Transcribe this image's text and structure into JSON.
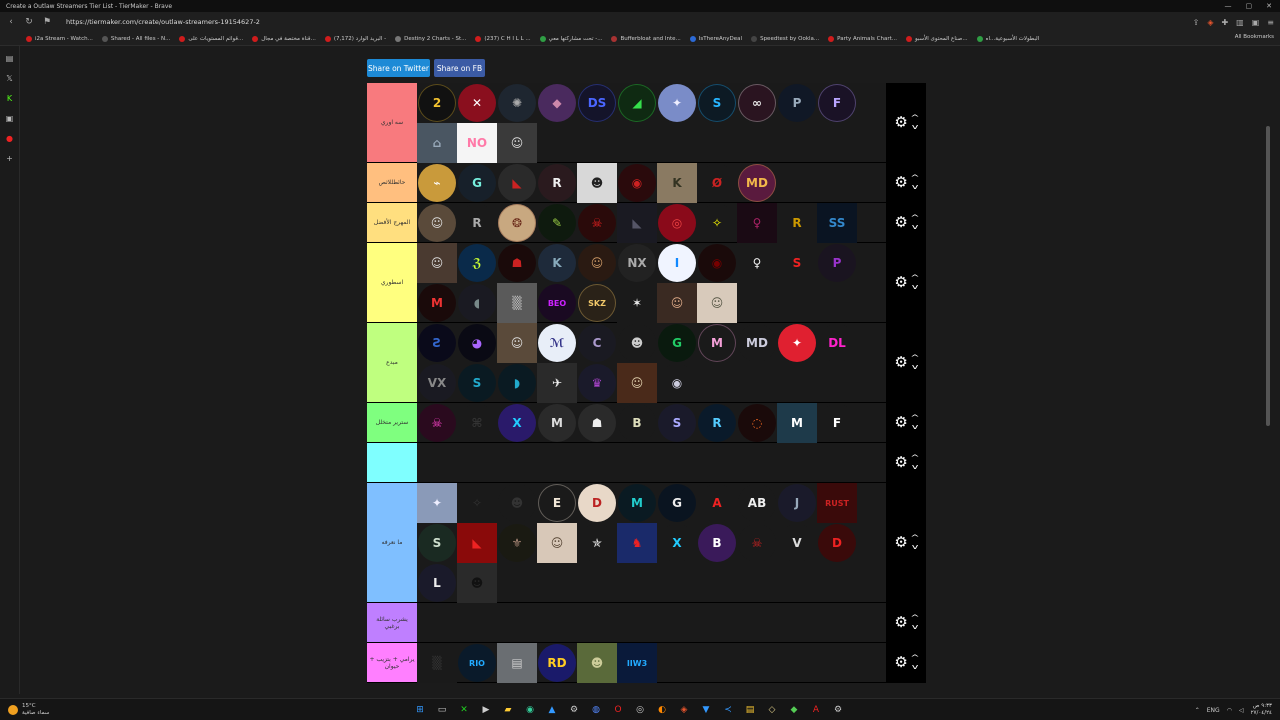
{
  "window": {
    "title": "Create a Outlaw Streamers Tier List - TierMaker - Brave"
  },
  "address_bar": {
    "url": "https://tiermaker.com/create/outlaw-streamers-19154627-2"
  },
  "bookmarks": [
    {
      "label": "i2a Stream - Watch...",
      "color": "#d01c1c"
    },
    {
      "label": "Shared - All files - N...",
      "color": "#555555"
    },
    {
      "label": "قوائم المستويات على...",
      "color": "#d01c1c"
    },
    {
      "label": "قناة مختصة في مجال...",
      "color": "#d01c1c"
    },
    {
      "label": "البريد الوارد (7,172) -",
      "color": "#d01c1c"
    },
    {
      "label": "Destiny 2 Charts - St...",
      "color": "#777777"
    },
    {
      "label": "(237) C H I L L ...",
      "color": "#d01c1c"
    },
    {
      "label": "تحت مشاركتها معي -...",
      "color": "#2f9e44"
    },
    {
      "label": "Bufferbloat and Inte...",
      "color": "#a83232"
    },
    {
      "label": "IsThereAnyDeal",
      "color": "#2c6ad6"
    },
    {
      "label": "Speedtest by Ookla...",
      "color": "#444444"
    },
    {
      "label": "Party Animals Chart...",
      "color": "#d01c1c"
    },
    {
      "label": "صناع المحتوى الأسبو...",
      "color": "#d01c1c"
    },
    {
      "label": "البطولات الأسبوعية...اه",
      "color": "#2f9e44"
    }
  ],
  "bookmarks_all": "All Bookmarks",
  "share": {
    "twitter": "Share on Twitter",
    "facebook": "Share on FB"
  },
  "tiers": [
    {
      "label": "سه اوري",
      "color": "#f87a7e",
      "height": 80,
      "items": [
        {
          "t": "2",
          "bg": "#111",
          "fg": "#f2c230",
          "s": "circ"
        },
        {
          "t": "✕",
          "bg": "#8a0f1e",
          "fg": "#fff"
        },
        {
          "t": "✺",
          "bg": "#1e2630",
          "fg": "#aaa"
        },
        {
          "t": "◆",
          "bg": "#4a2a5e",
          "fg": "#c8a"
        },
        {
          "t": "DS",
          "bg": "#14142a",
          "fg": "#4a66ff"
        },
        {
          "t": "◢",
          "bg": "#0f2a12",
          "fg": "#35e04b"
        },
        {
          "t": "✦",
          "bg": "#7a8cc8",
          "fg": "#eef"
        },
        {
          "t": "S",
          "bg": "#0d1a24",
          "fg": "#27b5ff"
        },
        {
          "t": "∞",
          "bg": "#2a1420",
          "fg": "#e8e8e8"
        },
        {
          "t": "P",
          "bg": "#101826",
          "fg": "#9ab"
        },
        {
          "t": "F",
          "bg": "#1a1226",
          "fg": "#b9a5ff"
        },
        {
          "t": "⌂",
          "bg": "#4a5662",
          "fg": "#9ab",
          "sq": true
        },
        {
          "t": "NO",
          "bg": "#f5f5f5",
          "fg": "#ff7aa8",
          "sq": true
        },
        {
          "t": "☺",
          "bg": "#3a3a3a",
          "fg": "#ddd",
          "sq": true
        }
      ]
    },
    {
      "label": "حائطللاثص",
      "color": "#ffbf7f",
      "height": 40,
      "items": [
        {
          "t": "⌁",
          "bg": "#c99a3b",
          "fg": "#fff"
        },
        {
          "t": "G",
          "bg": "#17202a",
          "fg": "#7ed"
        },
        {
          "t": "◣",
          "bg": "#2a2a2a",
          "fg": "#c22"
        },
        {
          "t": "R",
          "bg": "#2a1a1e",
          "fg": "#eee"
        },
        {
          "t": "☻",
          "bg": "#d8d8d8",
          "fg": "#222",
          "sq": true
        },
        {
          "t": "◉",
          "bg": "#2a0a0c",
          "fg": "#c22"
        },
        {
          "t": "K",
          "bg": "#8a7a62",
          "fg": "#332",
          "sq": true
        },
        {
          "t": "Ø",
          "bg": "#1a1a1a",
          "fg": "#c22"
        },
        {
          "t": "MD",
          "bg": "#5a1a3e",
          "fg": "#f2b84a"
        }
      ]
    },
    {
      "label": "المهرج الأفضل",
      "color": "#ffdf7f",
      "height": 40,
      "items": [
        {
          "t": "☺",
          "bg": "#5a4a3a",
          "fg": "#ddd"
        },
        {
          "t": "R",
          "bg": "#1a1a1a",
          "fg": "#aaa"
        },
        {
          "t": "❂",
          "bg": "#c8a880",
          "fg": "#6a2a1a"
        },
        {
          "t": "✎",
          "bg": "#0e1a0e",
          "fg": "#9c4"
        },
        {
          "t": "☠",
          "bg": "#2a0a0a",
          "fg": "#e22"
        },
        {
          "t": "◣",
          "bg": "#1a1a22",
          "fg": "#556",
          "sq": true
        },
        {
          "t": "◎",
          "bg": "#8a0a1a",
          "fg": "#e44"
        },
        {
          "t": "✧",
          "bg": "#1a1a1a",
          "fg": "#ff0"
        },
        {
          "t": "♀",
          "bg": "#1a0a14",
          "fg": "#a26",
          "sq": true
        },
        {
          "t": "R",
          "bg": "#1a1a1a",
          "fg": "#c90",
          "sq": true
        },
        {
          "t": "SS",
          "bg": "#0a1422",
          "fg": "#38c",
          "sq": true
        }
      ]
    },
    {
      "label": "اسطوري",
      "color": "#ffff7f",
      "height": 80,
      "items": [
        {
          "t": "☺",
          "bg": "#4a3a30",
          "fg": "#ddd",
          "sq": true
        },
        {
          "t": "ℨ",
          "bg": "#0a2a4a",
          "fg": "#cf3"
        },
        {
          "t": "☗",
          "bg": "#1a0a0a",
          "fg": "#c22"
        },
        {
          "t": "K",
          "bg": "#1e2a3a",
          "fg": "#8ab"
        },
        {
          "t": "☺",
          "bg": "#2a1a12",
          "fg": "#c96"
        },
        {
          "t": "NX",
          "bg": "#222",
          "fg": "#aaa"
        },
        {
          "t": "I",
          "bg": "#f0f4ff",
          "fg": "#18f"
        },
        {
          "t": "◉",
          "bg": "#1a0a0a",
          "fg": "#700"
        },
        {
          "t": "♀",
          "bg": "#1a1a1a",
          "fg": "#eee",
          "sq": true
        },
        {
          "t": "S",
          "bg": "#1a1a1a",
          "fg": "#e22",
          "sq": true
        },
        {
          "t": "P",
          "bg": "#1a1420",
          "fg": "#93c"
        },
        {
          "t": "M",
          "bg": "#1a0a0a",
          "fg": "#e33"
        },
        {
          "t": "◖",
          "bg": "#1a1a22",
          "fg": "#788"
        },
        {
          "t": "▒",
          "bg": "#5a5a5a",
          "fg": "#bbb",
          "sq": true
        },
        {
          "t": "BEO",
          "bg": "#1a0a22",
          "fg": "#c2f"
        },
        {
          "t": "SKZ",
          "bg": "#2a2218",
          "fg": "#f2c96a"
        },
        {
          "t": "✶",
          "bg": "#1a1a1a",
          "fg": "#eee",
          "sq": true
        },
        {
          "t": "☺",
          "bg": "#3a2a22",
          "fg": "#da8",
          "sq": true
        },
        {
          "t": "☺",
          "bg": "#d8cabb",
          "fg": "#554",
          "sq": true
        }
      ]
    },
    {
      "label": "مبدع",
      "color": "#bfff7f",
      "height": 80,
      "items": [
        {
          "t": "Ƨ",
          "bg": "#0a0a1a",
          "fg": "#36c"
        },
        {
          "t": "◕",
          "bg": "#0a0a14",
          "fg": "#a6f"
        },
        {
          "t": "☺",
          "bg": "#5a4a3a",
          "fg": "#ddd",
          "sq": true
        },
        {
          "t": "ℳ",
          "bg": "#e8eef8",
          "fg": "#338"
        },
        {
          "t": "C",
          "bg": "#1a1a22",
          "fg": "#a9c"
        },
        {
          "t": "☻",
          "bg": "#1a1a1a",
          "fg": "#ccc"
        },
        {
          "t": "G",
          "bg": "#0a1a0e",
          "fg": "#2c6"
        },
        {
          "t": "M",
          "bg": "#1a1a1a",
          "fg": "#f4a0d8"
        },
        {
          "t": "MD",
          "bg": "#1a1a1a",
          "fg": "#ccd"
        },
        {
          "t": "✦",
          "bg": "#e02030",
          "fg": "#fff"
        },
        {
          "t": "DL",
          "bg": "#1a1a1a",
          "fg": "#f2c"
        },
        {
          "t": "VX",
          "bg": "#1a1a22",
          "fg": "#888"
        },
        {
          "t": "S",
          "bg": "#0a1a22",
          "fg": "#2ac"
        },
        {
          "t": "◗",
          "bg": "#0a1a22",
          "fg": "#2ac"
        },
        {
          "t": "✈",
          "bg": "#2a2a2a",
          "fg": "#eee",
          "sq": true
        },
        {
          "t": "♛",
          "bg": "#1a1a2a",
          "fg": "#a4c"
        },
        {
          "t": "☺",
          "bg": "#4a2a1a",
          "fg": "#dca",
          "sq": true
        },
        {
          "t": "◉",
          "bg": "#1a1a1a",
          "fg": "#ccd"
        }
      ]
    },
    {
      "label": "سترير متخلل",
      "color": "#7fff7f",
      "height": 40,
      "items": [
        {
          "t": "☠",
          "bg": "#2a0a1e",
          "fg": "#f4c"
        },
        {
          "t": "⌘",
          "bg": "#1a1a1a",
          "fg": "#333"
        },
        {
          "t": "X",
          "bg": "#2a1a6a",
          "fg": "#2cf"
        },
        {
          "t": "M",
          "bg": "#2a2a2a",
          "fg": "#ddd"
        },
        {
          "t": "☗",
          "bg": "#2a2a2a",
          "fg": "#eee"
        },
        {
          "t": "B",
          "bg": "#1a1a1a",
          "fg": "#ddb"
        },
        {
          "t": "S",
          "bg": "#1a1a2a",
          "fg": "#aaf"
        },
        {
          "t": "R",
          "bg": "#0a1a2a",
          "fg": "#5cf"
        },
        {
          "t": "◌",
          "bg": "#1a0a0a",
          "fg": "#e62"
        },
        {
          "t": "M",
          "bg": "#1e3a4a",
          "fg": "#fff",
          "sq": true
        },
        {
          "t": "F",
          "bg": "#1a1a1a",
          "fg": "#fff"
        }
      ]
    },
    {
      "label": "",
      "color": "#7fffff",
      "height": 40,
      "items": []
    },
    {
      "label": "ما نعرفه",
      "color": "#7fbfff",
      "height": 120,
      "items": [
        {
          "t": "✦",
          "bg": "#8a9ab8",
          "fg": "#eef",
          "sq": true
        },
        {
          "t": "✧",
          "bg": "#1a1a1a",
          "fg": "#333",
          "sq": true
        },
        {
          "t": "☻",
          "bg": "#1a1a1a",
          "fg": "#333"
        },
        {
          "t": "E",
          "bg": "#1a1a1a",
          "fg": "#f2e8d8"
        },
        {
          "t": "D",
          "bg": "#e8d8c8",
          "fg": "#b22"
        },
        {
          "t": "M",
          "bg": "#0a1a22",
          "fg": "#2cc"
        },
        {
          "t": "G",
          "bg": "#0a1420",
          "fg": "#eee"
        },
        {
          "t": "A",
          "bg": "#1a1a1a",
          "fg": "#e22"
        },
        {
          "t": "AB",
          "bg": "#1a1a1a",
          "fg": "#eee"
        },
        {
          "t": "J",
          "bg": "#1a1a2a",
          "fg": "#9ab"
        },
        {
          "t": "RUST",
          "bg": "#3a0a0a",
          "fg": "#c22",
          "sq": true
        },
        {
          "t": "S",
          "bg": "#1a2a22",
          "fg": "#cdc"
        },
        {
          "t": "◣",
          "bg": "#8a0a0a",
          "fg": "#e22",
          "sq": true
        },
        {
          "t": "⚜",
          "bg": "#1a1a12",
          "fg": "#a87"
        },
        {
          "t": "☺",
          "bg": "#d8c8b8",
          "fg": "#543",
          "sq": true
        },
        {
          "t": "✯",
          "bg": "#1a1a1a",
          "fg": "#eee"
        },
        {
          "t": "♞",
          "bg": "#1a2a6a",
          "fg": "#e22",
          "sq": true
        },
        {
          "t": "X",
          "bg": "#1a1a1a",
          "fg": "#2cf"
        },
        {
          "t": "B",
          "bg": "#3a1a5a",
          "fg": "#fff"
        },
        {
          "t": "☠",
          "bg": "#1a1a1a",
          "fg": "#c22"
        },
        {
          "t": "V",
          "bg": "#1a1a1a",
          "fg": "#ddd"
        },
        {
          "t": "D",
          "bg": "#3a0a0a",
          "fg": "#e22"
        },
        {
          "t": "L",
          "bg": "#1a1a2a",
          "fg": "#eee"
        },
        {
          "t": "☻",
          "bg": "#2a2a2a",
          "fg": "#111",
          "sq": true
        }
      ]
    },
    {
      "label": "يشرب سائلة برغبي",
      "color": "#bf7fff",
      "height": 40,
      "items": []
    },
    {
      "label": "يرامي + بتزيب + حيوان",
      "color": "#ff7fff",
      "height": 40,
      "items": [
        {
          "t": "▒",
          "bg": "#1a1a1a",
          "fg": "#333",
          "sq": true
        },
        {
          "t": "RIO",
          "bg": "#0a1a2a",
          "fg": "#2af"
        },
        {
          "t": "▤",
          "bg": "#6a6e72",
          "fg": "#ccc",
          "sq": true
        },
        {
          "t": "RD",
          "bg": "#1a1a6a",
          "fg": "#fc2"
        },
        {
          "t": "☻",
          "bg": "#5a6a3a",
          "fg": "#cc9",
          "sq": true
        },
        {
          "t": "IIW3",
          "bg": "#0a1a3a",
          "fg": "#2af",
          "sq": true
        }
      ]
    }
  ],
  "taskbar": {
    "weather_temp": "15°C",
    "weather_desc": "سماء صافية",
    "lang": "ENG",
    "time": "٩:٣٣ ص",
    "date": "٢٧/٠٤/٢٤"
  }
}
